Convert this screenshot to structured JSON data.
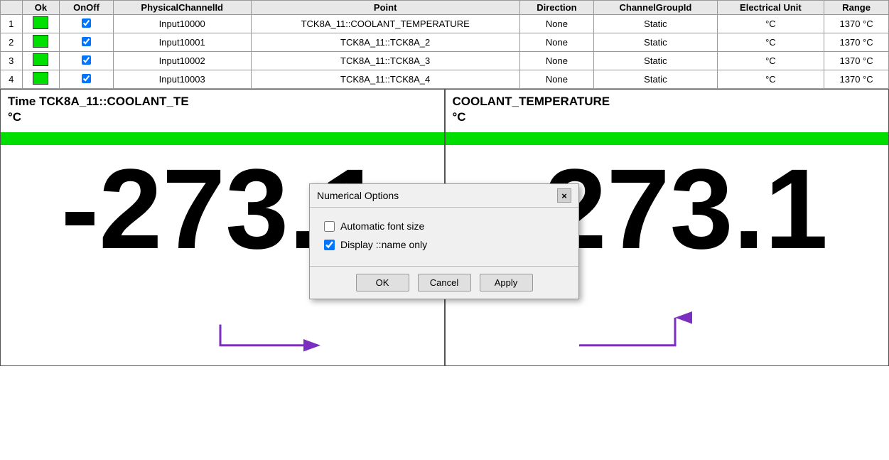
{
  "table": {
    "headers": [
      "",
      "Ok",
      "OnOff",
      "PhysicalChannelId",
      "Point",
      "Direction",
      "ChannelGroupId",
      "Electrical Unit",
      "Range"
    ],
    "rows": [
      {
        "row_num": "1",
        "ok": true,
        "onoff": true,
        "physical_channel_id": "Input10000",
        "point": "TCK8A_11::COOLANT_TEMPERATURE",
        "direction": "None",
        "channel_group_id": "Static",
        "electrical_unit": "°C",
        "range": "1370 °C",
        "point_selected": true
      },
      {
        "row_num": "2",
        "ok": true,
        "onoff": true,
        "physical_channel_id": "Input10001",
        "point": "TCK8A_11::TCK8A_2",
        "direction": "None",
        "channel_group_id": "Static",
        "electrical_unit": "°C",
        "range": "1370 °C",
        "point_selected": false
      },
      {
        "row_num": "3",
        "ok": true,
        "onoff": true,
        "physical_channel_id": "Input10002",
        "point": "TCK8A_11::TCK8A_3",
        "direction": "None",
        "channel_group_id": "Static",
        "electrical_unit": "°C",
        "range": "1370 °C",
        "point_selected": false
      },
      {
        "row_num": "4",
        "ok": true,
        "onoff": true,
        "physical_channel_id": "Input10003",
        "point": "TCK8A_11::TCK8A_4",
        "direction": "None",
        "channel_group_id": "Static",
        "electrical_unit": "°C",
        "range": "1370 °C",
        "point_selected": false
      }
    ]
  },
  "panel_left": {
    "title_line1": "Time  TCK8A_11::COOLANT_TE",
    "title_line2": "°C",
    "value": "-273.1"
  },
  "panel_right": {
    "title_line1": "COOLANT_TEMPERATURE",
    "title_line2": "°C",
    "value": "-273.1"
  },
  "dialog": {
    "title": "Numerical Options",
    "close_label": "×",
    "option1_label": "Automatic font size",
    "option1_checked": false,
    "option2_label": "Display ::name only",
    "option2_checked": true,
    "btn_ok": "OK",
    "btn_cancel": "Cancel",
    "btn_apply": "Apply"
  }
}
